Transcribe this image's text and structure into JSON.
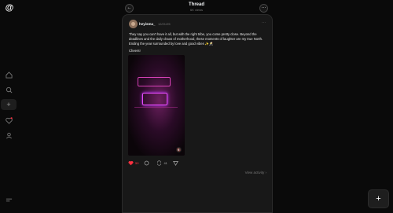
{
  "header": {
    "title": "Thread",
    "subtitle": "6K views"
  },
  "post": {
    "username": "heyisma_",
    "date": "12/21/25",
    "text": "They say you can't have it all, but with the right tribe, you come pretty close. Beyond the deadlines and the daily chaos of motherhood, these moments of laughter are my true North. Ending the year surrounded by love and good vibes ✨🥂",
    "text2": "Cheers!",
    "like_count": "59",
    "reply_count": "",
    "repost_count": "41",
    "share_count": ""
  },
  "footer": {
    "view_activity": "View activity ›"
  },
  "icons": {
    "logo": "threads-logo-icon",
    "home": "home-icon",
    "search": "search-icon",
    "create": "plus-icon",
    "activity": "heart-icon",
    "profile": "person-icon",
    "menu": "menu-icon"
  }
}
